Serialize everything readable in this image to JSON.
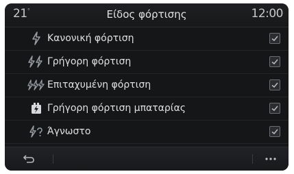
{
  "header": {
    "temperature": "21",
    "temperature_unit": "°",
    "title": "Είδος φόρτισης",
    "clock": "12:00"
  },
  "charging_types": [
    {
      "label": "Κανονική φόρτιση",
      "icon": "normal-charge-icon",
      "checked": true
    },
    {
      "label": "Γρήγορη φόρτιση",
      "icon": "fast-charge-icon",
      "checked": true
    },
    {
      "label": "Επιταχυμένη φόρτιση",
      "icon": "accelerated-charge-icon",
      "checked": true
    },
    {
      "label": "Γρήγορη φόρτιση μπαταρίας",
      "icon": "battery-fast-charge-icon",
      "checked": true
    },
    {
      "label": "Άγνωστο",
      "icon": "unknown-charge-icon",
      "checked": true
    }
  ],
  "footer": {
    "back_icon": "back-arrow-icon",
    "more_icon": "more-options-icon",
    "more_label": "···"
  },
  "colors": {
    "background": "#141618",
    "text": "#e0e0e0",
    "icon": "#9a9ea3"
  }
}
